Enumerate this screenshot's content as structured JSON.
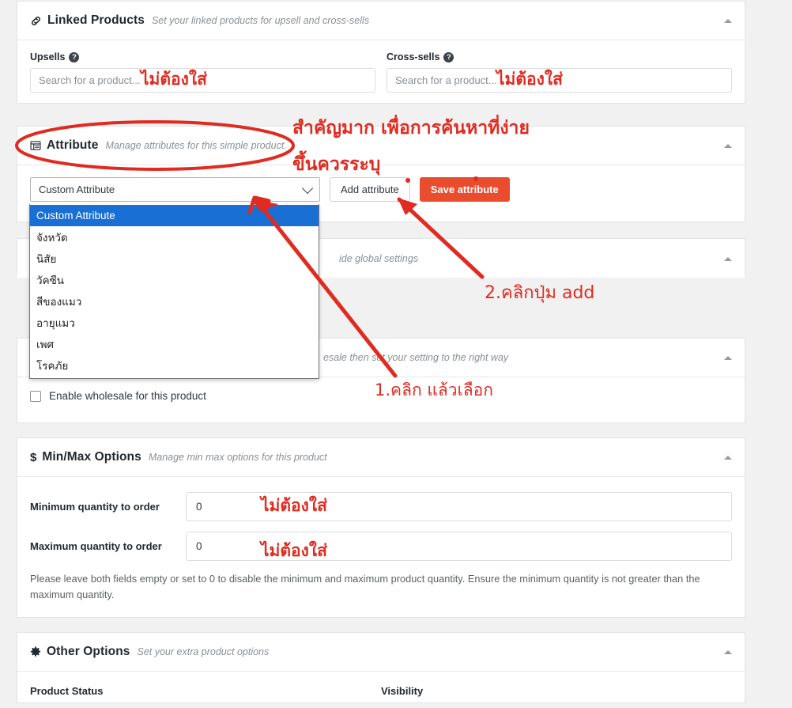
{
  "colors": {
    "accent_orange": "#ea4c2e",
    "select_highlight_blue": "#1a6fd4",
    "annotation_red": "#e02b20",
    "page_background": "#f1f1f1",
    "panel_background": "#ffffff"
  },
  "linked_products": {
    "icon": "link-icon",
    "title": "Linked Products",
    "subtitle": "Set your linked products for upsell and cross-sells",
    "collapse_icon": "caret-up-icon",
    "upsells": {
      "label": "Upsells",
      "help_icon": "question-mark-icon",
      "value": "",
      "placeholder": "Search for a product..."
    },
    "cross_sells": {
      "label": "Cross-sells",
      "help_icon": "question-mark-icon",
      "value": "",
      "placeholder": "Search for a product..."
    }
  },
  "attribute": {
    "icon": "table-list-icon",
    "title": "Attribute",
    "subtitle": "Manage attributes for this simple product.",
    "collapse_icon": "caret-up-icon",
    "select": {
      "selected": "Custom Attribute",
      "chevron_icon": "chevron-down-icon",
      "options": [
        "Custom Attribute",
        "จังหวัด",
        "นิสัย",
        "วัคซีน",
        "สีของแมว",
        "อายุแมว",
        "เพศ",
        "โรคภัย"
      ],
      "highlighted_index": 0
    },
    "add_button": "Add attribute",
    "save_button": "Save attribute"
  },
  "hidden_panel_a": {
    "subtitle_fragment": "ide global settings",
    "collapse_icon": "caret-up-icon"
  },
  "wholesale": {
    "subtitle_fragment": "esale then set your setting to the right way",
    "collapse_icon": "caret-up-icon",
    "checkbox_label": "Enable wholesale for this product",
    "checked": false
  },
  "min_max": {
    "icon": "dollar-icon",
    "title": "Min/Max Options",
    "subtitle": "Manage min max options for this product",
    "collapse_icon": "caret-up-icon",
    "rows": [
      {
        "label": "Minimum quantity to order",
        "value": "0"
      },
      {
        "label": "Maximum quantity to order",
        "value": "0"
      }
    ],
    "note": "Please leave both fields empty or set to 0 to disable the minimum and maximum product quantity. Ensure the minimum quantity is not greater than the maximum quantity."
  },
  "other_options": {
    "icon": "gear-icon",
    "title": "Other Options",
    "subtitle": "Set your extra product options",
    "collapse_icon": "caret-up-icon",
    "columns": [
      "Product Status",
      "Visibility"
    ]
  },
  "annotations": [
    {
      "id": "upsells-note",
      "text": "ไม่ต้องใส่"
    },
    {
      "id": "cross-sells-note",
      "text": "ไม่ต้องใส่"
    },
    {
      "id": "attribute-important-line1",
      "text": "สำคัญมาก เพื่อการค้นหาที่ง่าย"
    },
    {
      "id": "attribute-important-line2",
      "text": "ขึ้นควรระบุ"
    },
    {
      "id": "step-2-click-add",
      "text": "2.คลิกปุ่ม add"
    },
    {
      "id": "step-1-click-select",
      "text": "1.คลิก แล้วเลือก"
    },
    {
      "id": "minimum-qty-note",
      "text": "ไม่ต้องใส่"
    },
    {
      "id": "maximum-qty-note",
      "text": "ไม่ต้องใส่"
    }
  ]
}
